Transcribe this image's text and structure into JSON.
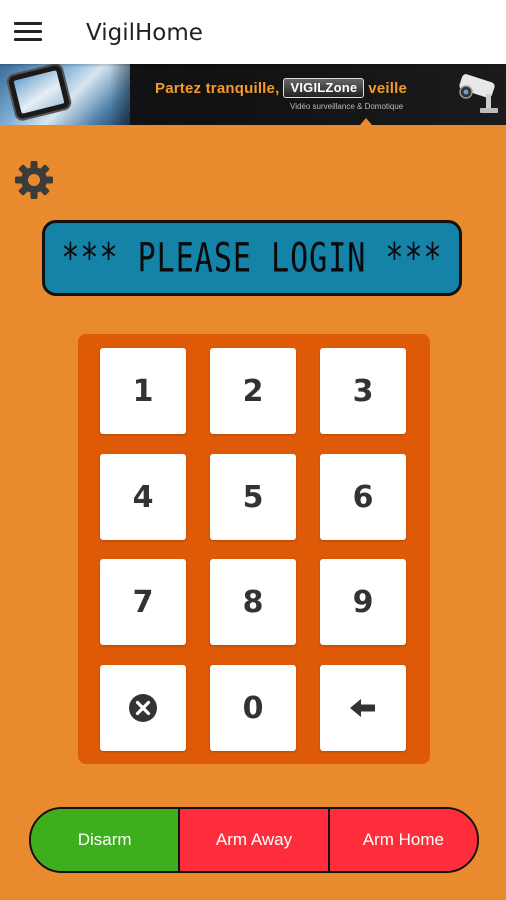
{
  "app_bar": {
    "title": "VigilHome",
    "menu_icon": "hamburger-menu-icon"
  },
  "banner": {
    "tagline_start": "Partez tranquille,",
    "brand_part1": "VIGIL",
    "brand_part2": "Zone",
    "tagline_end": "veille",
    "subtitle": "Vidéo surveillance & Domotique",
    "camera_icon": "security-camera-icon"
  },
  "settings": {
    "icon": "gear-icon"
  },
  "display": {
    "text": "*** PLEASE LOGIN ***",
    "color": "#1582A8"
  },
  "keypad": {
    "keys": [
      {
        "label": "1"
      },
      {
        "label": "2"
      },
      {
        "label": "3"
      },
      {
        "label": "4"
      },
      {
        "label": "5"
      },
      {
        "label": "6"
      },
      {
        "label": "7"
      },
      {
        "label": "8"
      },
      {
        "label": "9"
      },
      {
        "label": "",
        "icon": "clear-x-circle-icon"
      },
      {
        "label": "0"
      },
      {
        "label": "",
        "icon": "backspace-arrow-icon"
      }
    ],
    "background_color": "#DE5A06"
  },
  "modes": {
    "disarm": "Disarm",
    "arm_away": "Arm Away",
    "arm_home": "Arm Home",
    "disarm_color": "#3DAE1C",
    "arm_color": "#FF2D3C"
  },
  "colors": {
    "background": "#E98A2E"
  }
}
